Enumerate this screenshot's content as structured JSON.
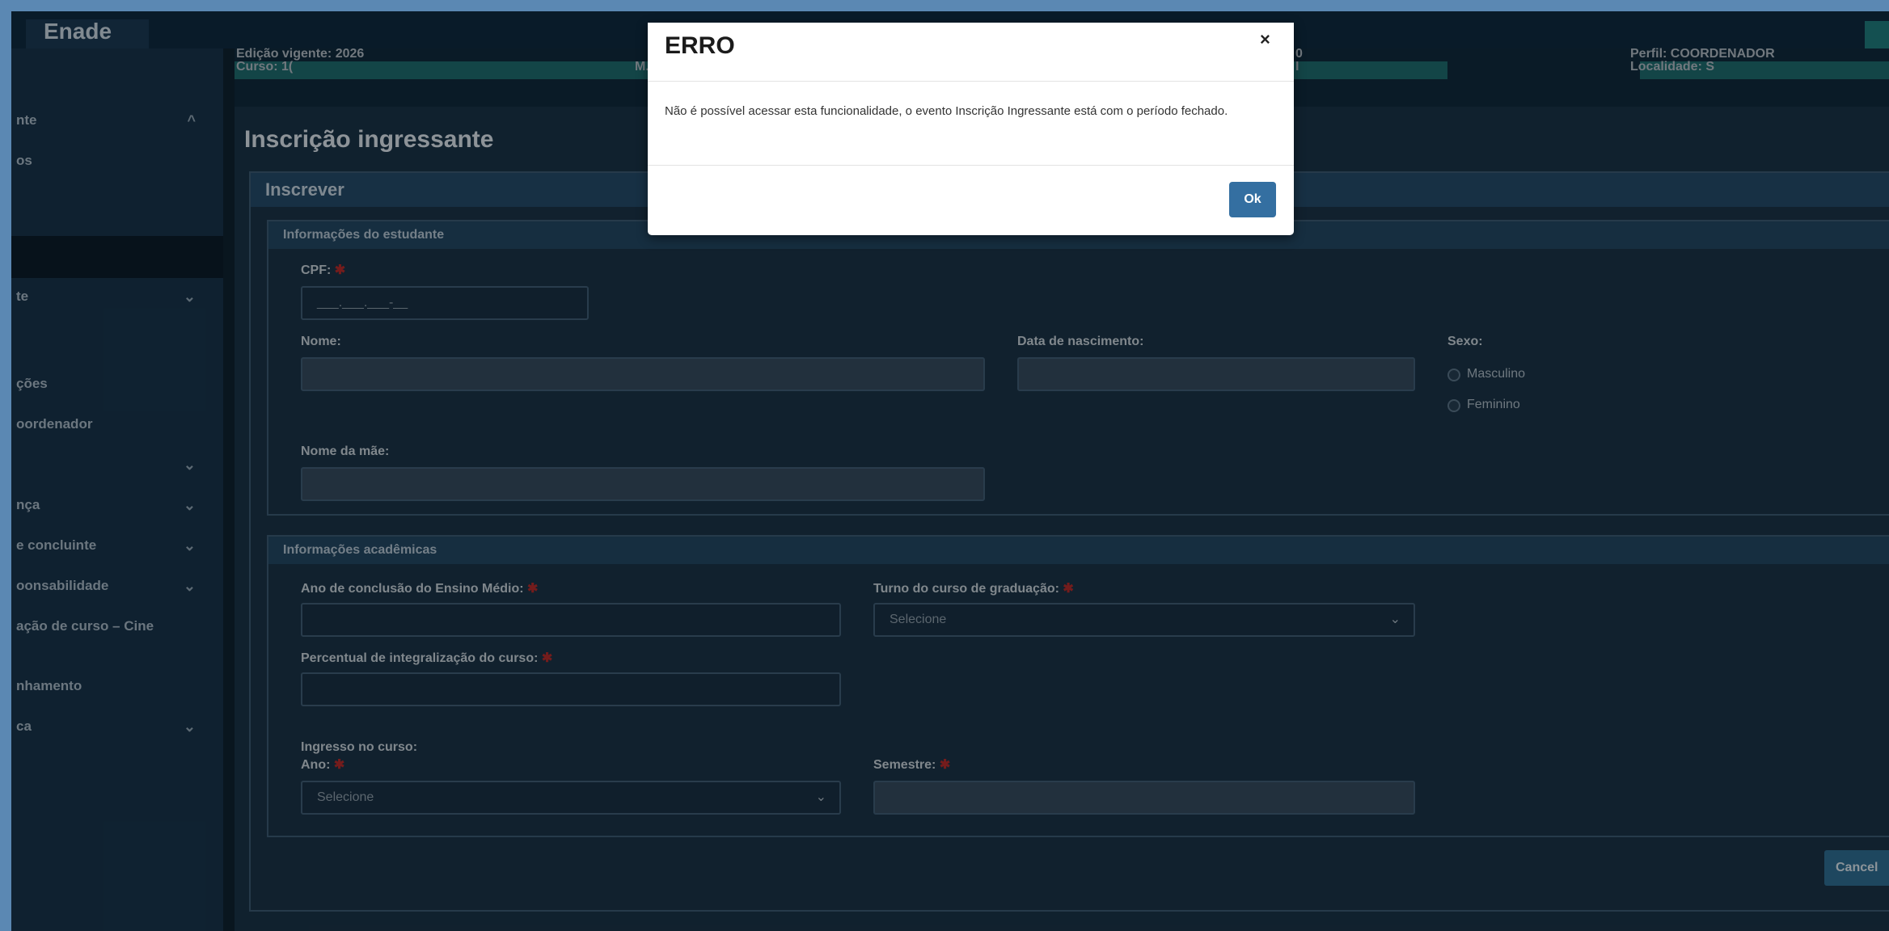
{
  "app": {
    "brand": "Enade"
  },
  "header": {
    "edicao_label": "Edição vigente: 2026",
    "curso_label": "Curso: 1(",
    "m_fragment": "M.",
    "mid_fragment_1": "0",
    "mid_fragment_2": "I",
    "perfil_label": "Perfil: COORDENADOR",
    "localidade_label": "Localidade: S"
  },
  "sidebar": {
    "items": [
      {
        "label": "nte",
        "chevron": "^"
      },
      {
        "label": "os",
        "chevron": ""
      },
      {
        "label": "te",
        "chevron": "v"
      },
      {
        "label": "ções",
        "chevron": ""
      },
      {
        "label": "oordenador",
        "chevron": ""
      },
      {
        "label": "",
        "chevron": "v"
      },
      {
        "label": "nça",
        "chevron": "v"
      },
      {
        "label": "e concluinte",
        "chevron": "v"
      },
      {
        "label": "oonsabilidade",
        "chevron": "v"
      },
      {
        "label": "ação de curso – Cine",
        "chevron": ""
      },
      {
        "label": "nhamento",
        "chevron": ""
      },
      {
        "label": "ca",
        "chevron": "v"
      }
    ]
  },
  "page": {
    "title": "Inscrição ingressante"
  },
  "panel": {
    "title": "Inscrever",
    "cancel_label": "Cancel"
  },
  "student": {
    "title": "Informações do estudante",
    "cpf_label": "CPF:",
    "cpf_placeholder": "___.___.___-__",
    "nome_label": "Nome:",
    "nascimento_label": "Data de nascimento:",
    "sexo_label": "Sexo:",
    "sexo_options": [
      "Masculino",
      "Feminino"
    ],
    "mae_label": "Nome da mãe:"
  },
  "academic": {
    "title": "Informações acadêmicas",
    "ano_conclusao_label": "Ano de conclusão do Ensino Médio:",
    "turno_label": "Turno do curso de graduação:",
    "turno_value": "Selecione",
    "percentual_label": "Percentual de integralização do curso:",
    "ingresso_label": "Ingresso no curso:",
    "ano_label": "Ano:",
    "ano_value": "Selecione",
    "semestre_label": "Semestre:"
  },
  "modal": {
    "title": "ERRO",
    "close": "×",
    "message": "Não é possível acessar esta funcionalidade, o evento Inscrição Ingressante está com o período fechado.",
    "ok_label": "Ok"
  },
  "common": {
    "required_mark": "✱",
    "chevron": "⌄"
  }
}
